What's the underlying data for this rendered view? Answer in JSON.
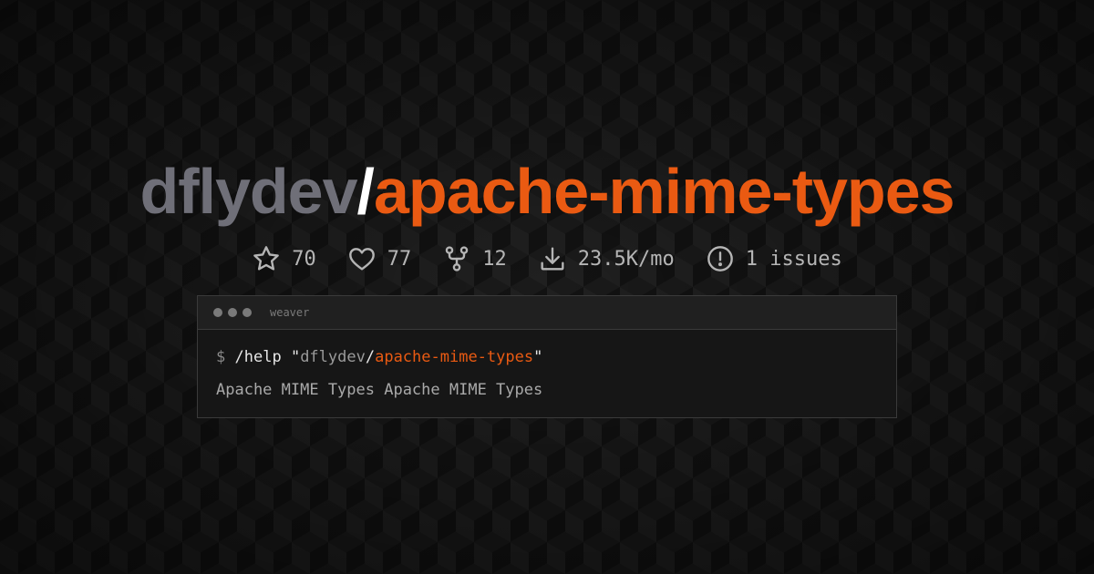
{
  "repo": {
    "owner": "dflydev",
    "separator": "/",
    "name": "apache-mime-types"
  },
  "stats": [
    {
      "icon": "star-icon",
      "value": "70"
    },
    {
      "icon": "heart-icon",
      "value": "77"
    },
    {
      "icon": "fork-icon",
      "value": "12"
    },
    {
      "icon": "download-icon",
      "value": "23.5K/mo"
    },
    {
      "icon": "issue-icon",
      "value": "1 issues"
    }
  ],
  "terminal": {
    "title": "weaver",
    "prompt": "$",
    "command": "/help",
    "quote_open": "\"",
    "quote_close": "\"",
    "output": "Apache MIME Types Apache MIME Types"
  },
  "colors": {
    "accent": "#ea5a12",
    "owner": "#6f6f78",
    "background": "#121212"
  }
}
